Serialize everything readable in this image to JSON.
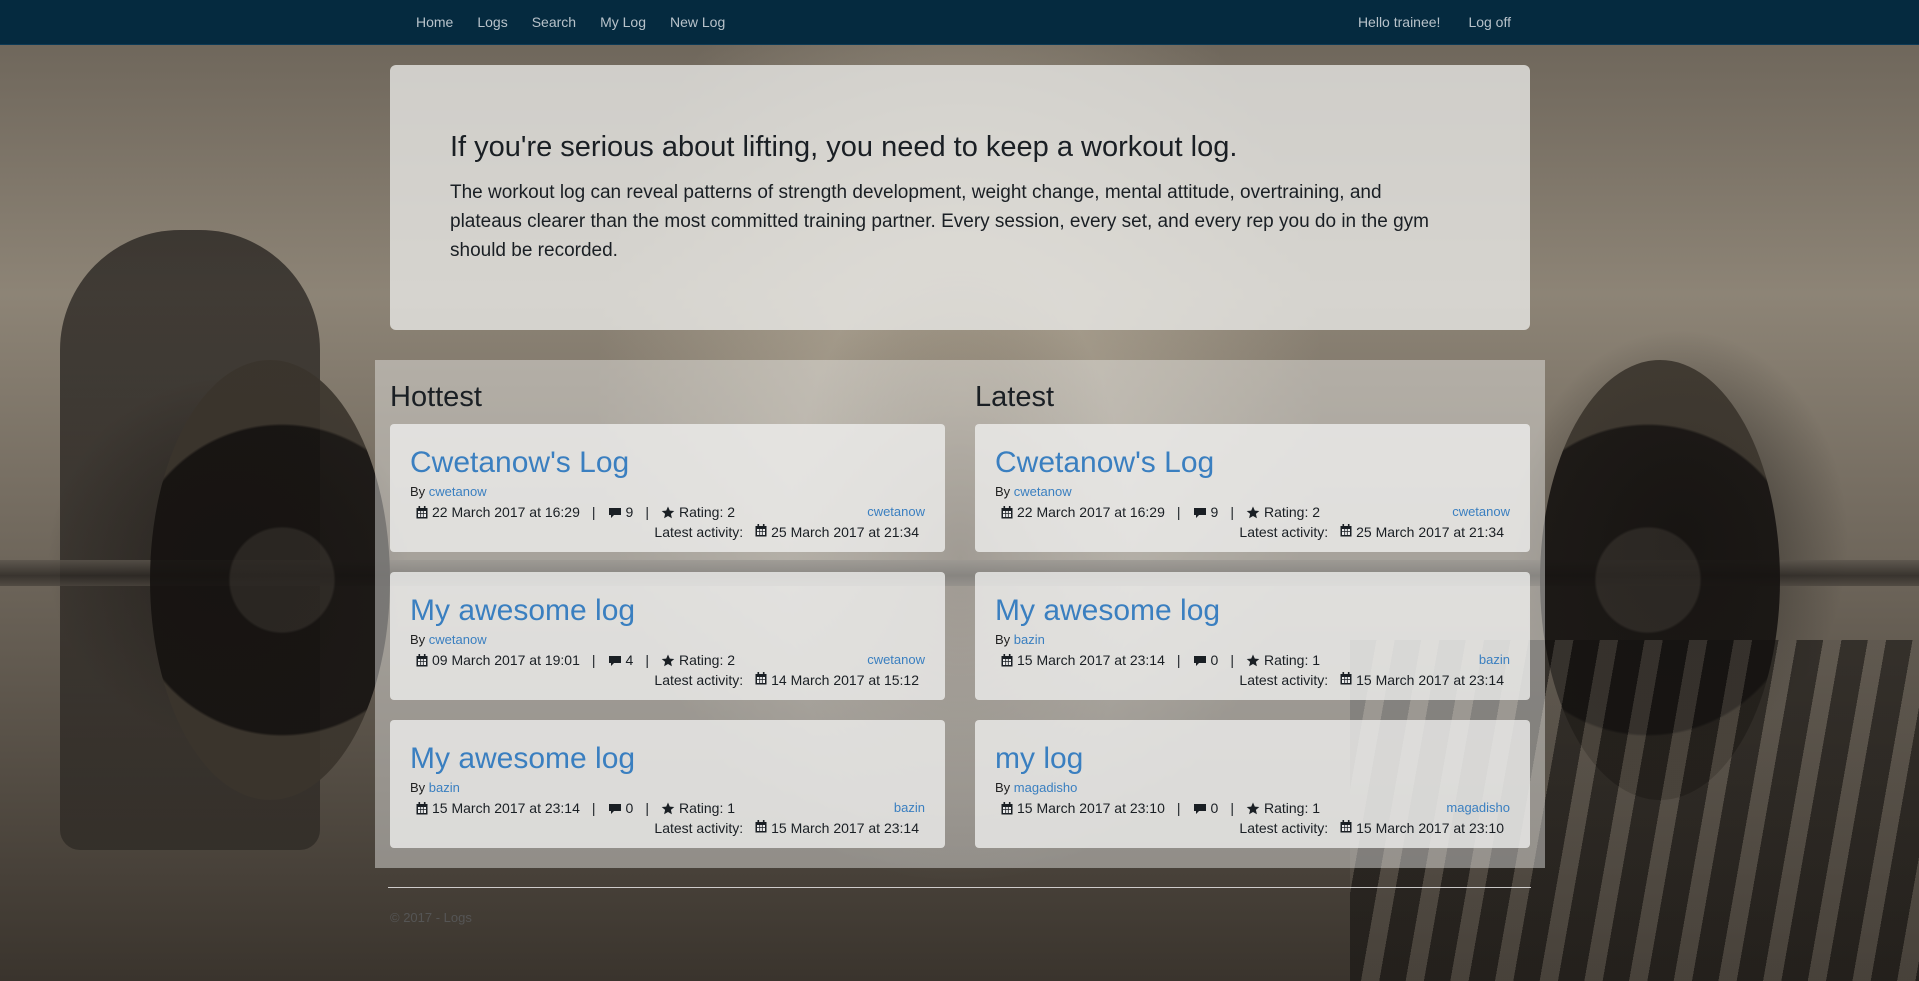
{
  "nav": {
    "left": [
      "Home",
      "Logs",
      "Search",
      "My Log",
      "New Log"
    ],
    "greeting": "Hello trainee!",
    "logoff": "Log off"
  },
  "jumbotron": {
    "heading": "If you're serious about lifting, you need to keep a workout log.",
    "text": "The workout log can reveal patterns of strength development, weight change, mental attitude, overtraining, and plateaus clearer than the most committed training partner. Every session, every set, and every rep you do in the gym should be recorded."
  },
  "labels": {
    "by": "By",
    "rating": "Rating:",
    "latest_activity": "Latest activity:",
    "sep": "|"
  },
  "hottest": {
    "title": "Hottest",
    "cards": [
      {
        "title": "Cwetanow's Log",
        "author": "cwetanow",
        "created": "22 March 2017 at 16:29",
        "comments": "9",
        "rating": "2",
        "owner": "cwetanow",
        "activity": "25 March 2017 at 21:34"
      },
      {
        "title": "My awesome log",
        "author": "cwetanow",
        "created": "09 March 2017 at 19:01",
        "comments": "4",
        "rating": "2",
        "owner": "cwetanow",
        "activity": "14 March 2017 at 15:12"
      },
      {
        "title": "My awesome log",
        "author": "bazin",
        "created": "15 March 2017 at 23:14",
        "comments": "0",
        "rating": "1",
        "owner": "bazin",
        "activity": "15 March 2017 at 23:14"
      }
    ]
  },
  "latest": {
    "title": "Latest",
    "cards": [
      {
        "title": "Cwetanow's Log",
        "author": "cwetanow",
        "created": "22 March 2017 at 16:29",
        "comments": "9",
        "rating": "2",
        "owner": "cwetanow",
        "activity": "25 March 2017 at 21:34"
      },
      {
        "title": "My awesome log",
        "author": "bazin",
        "created": "15 March 2017 at 23:14",
        "comments": "0",
        "rating": "1",
        "owner": "bazin",
        "activity": "15 March 2017 at 23:14"
      },
      {
        "title": "my log",
        "author": "magadisho",
        "created": "15 March 2017 at 23:10",
        "comments": "0",
        "rating": "1",
        "owner": "magadisho",
        "activity": "15 March 2017 at 23:10"
      }
    ]
  },
  "footer": {
    "text": "© 2017 - Logs"
  },
  "colors": {
    "navbar": "#052a3f",
    "link": "#3a7fc0",
    "nav_text": "#b8c2ca"
  }
}
